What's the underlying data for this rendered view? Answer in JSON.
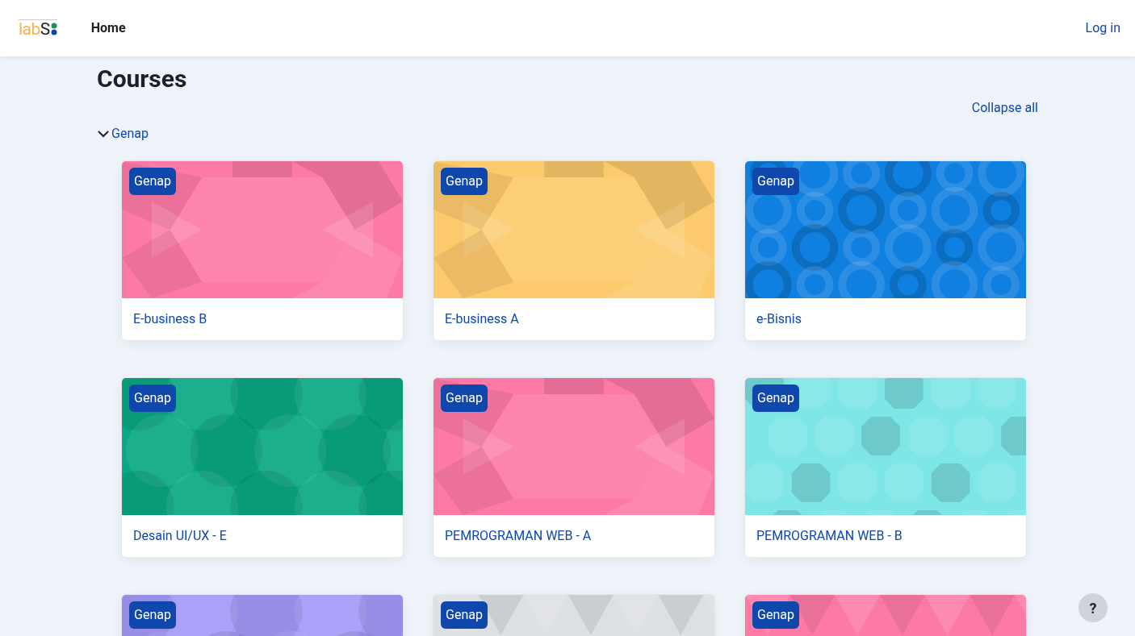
{
  "header": {
    "logo": {
      "part_1": "lab",
      "part_2": "S"
    },
    "nav": [
      {
        "label": "Home",
        "selected": true
      }
    ],
    "login": "Log in"
  },
  "page_title": "Courses",
  "collapse_all": "Collapse all",
  "section": {
    "title": "Genap",
    "expanded": true
  },
  "courses": [
    {
      "badge": "Genap",
      "name": "E-business B",
      "kind": "hexagons",
      "color": "#fd7aa7"
    },
    {
      "badge": "Genap",
      "name": "E-business A",
      "kind": "hexagons",
      "color": "#fcca6c"
    },
    {
      "badge": "Genap",
      "name": "e-Bisnis",
      "kind": "rings",
      "color": "#0f7fe0"
    },
    {
      "badge": "Genap",
      "name": "Desain UI/UX - E",
      "kind": "bubbles",
      "color": "#0aa882"
    },
    {
      "badge": "Genap",
      "name": "PEMROGRAMAN WEB - A",
      "kind": "hexagons",
      "color": "#fd7aa7"
    },
    {
      "badge": "Genap",
      "name": "PEMROGRAMAN WEB - B",
      "kind": "octagons",
      "color": "#7ee6e6"
    },
    {
      "badge": "Genap",
      "kind": "bubbles",
      "color": "#a59af8"
    },
    {
      "badge": "Genap",
      "kind": "triangles",
      "color": "#dde0e3"
    },
    {
      "badge": "Genap",
      "kind": "triangles",
      "color": "#fd7aa7"
    }
  ],
  "help": "?"
}
